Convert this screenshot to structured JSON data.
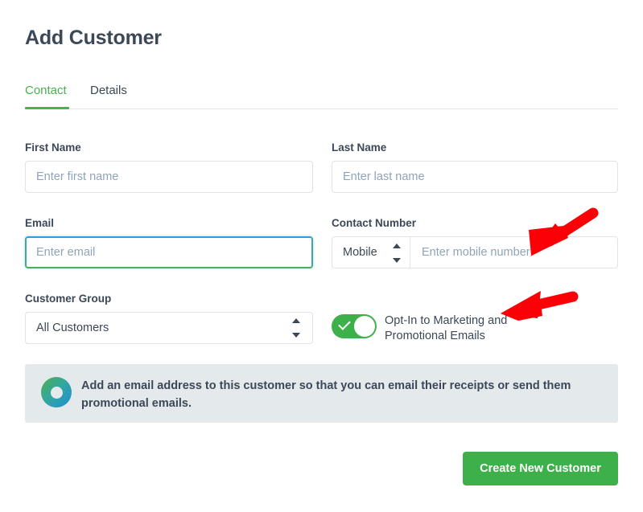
{
  "header": {
    "title": "Add Customer"
  },
  "tabs": [
    {
      "label": "Contact",
      "active": true
    },
    {
      "label": "Details",
      "active": false
    }
  ],
  "form": {
    "first_name": {
      "label": "First Name",
      "placeholder": "Enter first name",
      "value": ""
    },
    "last_name": {
      "label": "Last Name",
      "placeholder": "Enter last name",
      "value": ""
    },
    "email": {
      "label": "Email",
      "placeholder": "Enter email",
      "value": "",
      "focused": true
    },
    "contact_number": {
      "label": "Contact Number",
      "type_value": "Mobile",
      "type_options": [
        "Mobile"
      ],
      "placeholder": "Enter mobile number",
      "value": ""
    },
    "customer_group": {
      "label": "Customer Group",
      "value": "All Customers",
      "options": [
        "All Customers"
      ]
    },
    "opt_in": {
      "label": "Opt-In to Marketing and Promotional Emails",
      "checked": true
    }
  },
  "banner": {
    "text": "Add an email address to this customer so that you can email their receipts or send them promotional emails.",
    "icon": "info-ring-icon"
  },
  "actions": {
    "submit_label": "Create New Customer"
  },
  "colors": {
    "accent_green": "#3eb049",
    "tab_active_green": "#4caf50",
    "text_dark": "#3c4858",
    "placeholder": "#8fa4b8",
    "border": "#dfe4e8",
    "banner_bg": "#e4e9ec",
    "focus_blue": "#2f9be0",
    "annotation_red": "#fb0007"
  },
  "annotations": [
    {
      "name": "arrow-to-mobile-number-field",
      "direction": "down-left"
    },
    {
      "name": "arrow-to-optin-toggle",
      "direction": "left"
    }
  ]
}
